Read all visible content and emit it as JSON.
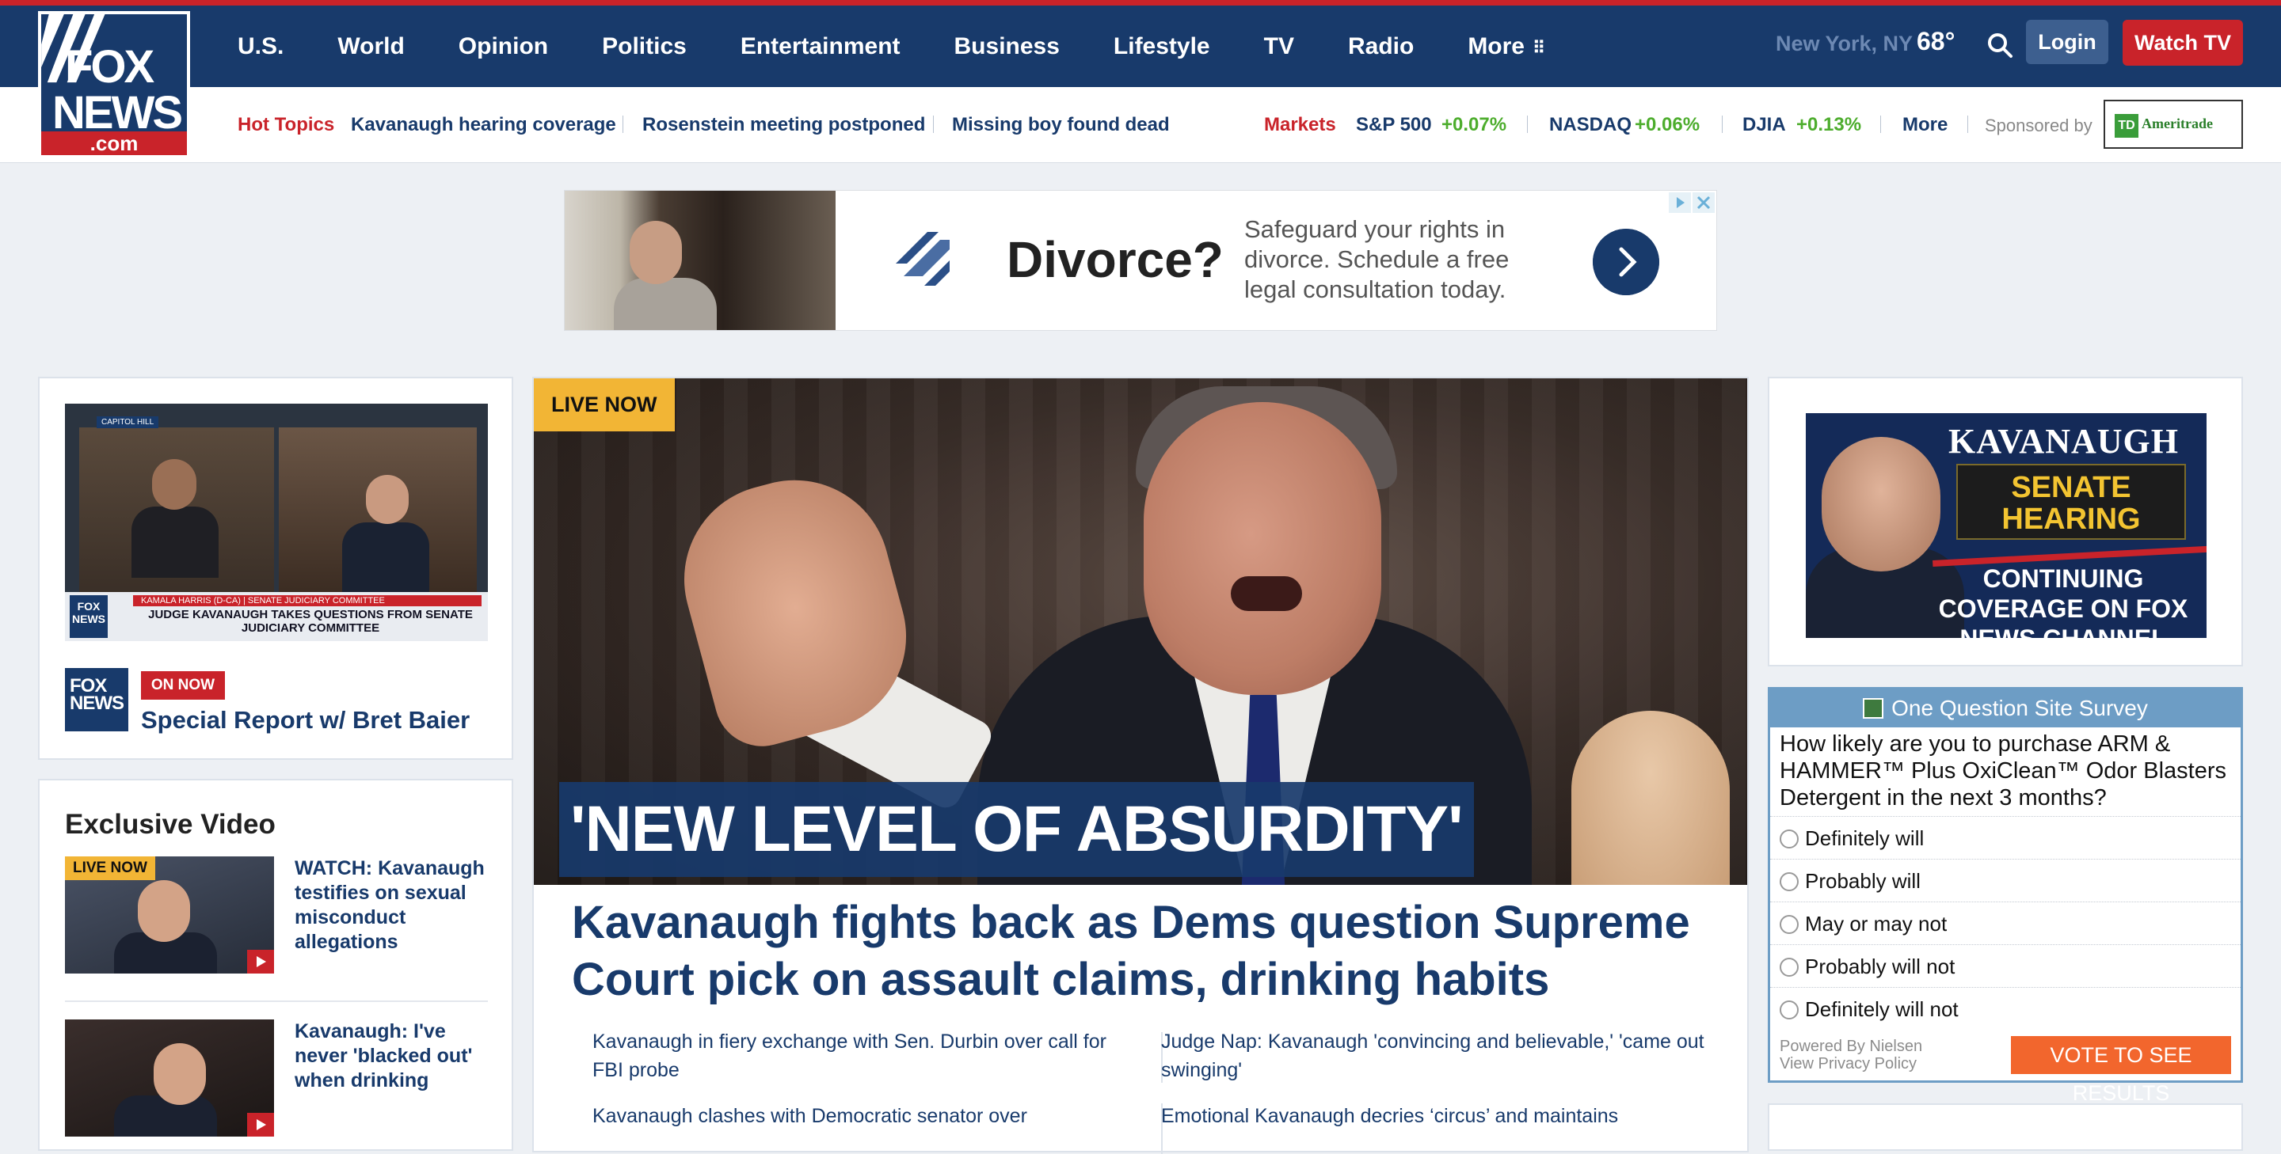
{
  "brand": {
    "logo_top": "FOX",
    "logo_bottom": "NEWS",
    "logo_suffix": ".com"
  },
  "nav": {
    "items": [
      "U.S.",
      "World",
      "Opinion",
      "Politics",
      "Entertainment",
      "Business",
      "Lifestyle",
      "TV",
      "Radio",
      "More"
    ]
  },
  "header": {
    "location": "New York, NY",
    "temperature": "68°",
    "login_label": "Login",
    "watch_label": "Watch TV"
  },
  "subbar": {
    "hot_topics_label": "Hot Topics",
    "topics": [
      "Kavanaugh hearing coverage",
      "Rosenstein meeting postponed",
      "Missing boy found dead"
    ],
    "markets_label": "Markets",
    "markets": [
      {
        "name": "S&P 500",
        "change": "+0.07%"
      },
      {
        "name": "NASDAQ",
        "change": "+0.06%"
      },
      {
        "name": "DJIA",
        "change": "+0.13%"
      }
    ],
    "more_label": "More",
    "sponsored_label": "Sponsored by",
    "sponsor_name": "Ameritrade",
    "sponsor_badge": "TD"
  },
  "ad_banner": {
    "headline": "Divorce?",
    "copy": "Safeguard your rights in divorce. Schedule a free legal consultation today."
  },
  "live_show": {
    "lower_third_bar": "KAMALA HARRIS (D-CA) | SENATE JUDICIARY COMMITTEE",
    "lower_third_text": "JUDGE KAVANAUGH TAKES QUESTIONS FROM SENATE JUDICIARY COMMITTEE",
    "location_tag": "CAPITOL HILL",
    "channel_logo": "FOX NEWS",
    "on_now_label": "ON NOW",
    "title": "Special Report w/ Bret Baier"
  },
  "exclusive_video": {
    "heading": "Exclusive Video",
    "items": [
      {
        "badge": "LIVE NOW",
        "title": "WATCH: Kavanaugh testifies on sexual misconduct allegations"
      },
      {
        "badge": "",
        "title": "Kavanaugh: I've never 'blacked out' when drinking"
      }
    ]
  },
  "main_story": {
    "live_badge": "LIVE NOW",
    "quote": "'NEW LEVEL OF ABSURDITY'",
    "headline": "Kavanaugh fights back as Dems question Supreme Court pick on assault claims, drinking habits",
    "related": [
      "Kavanaugh in fiery exchange with Sen. Durbin over call for FBI probe",
      "Judge Nap: Kavanaugh 'convincing and believable,' 'came out swinging'",
      "Kavanaugh clashes with Democratic senator over",
      "Emotional Kavanaugh decries ‘circus’ and maintains"
    ]
  },
  "side_ad": {
    "line1": "KAVANAUGH",
    "line2": "SENATE HEARING",
    "line3": "CONTINUING COVERAGE ON FOX NEWS CHANNEL"
  },
  "survey": {
    "title": "One Question Site Survey",
    "question": "How likely are you to purchase ARM & HAMMER™ Plus OxiClean™ Odor Blasters Detergent in the next 3 months?",
    "options": [
      "Definitely will",
      "Probably will",
      "May or may not",
      "Probably will not",
      "Definitely will not"
    ],
    "powered_by": "Powered By Nielsen",
    "privacy": "View Privacy Policy",
    "vote_label": "VOTE TO SEE RESULTS"
  },
  "colors": {
    "navy": "#183a6b",
    "red": "#c9232a",
    "gold": "#f2b535",
    "green": "#4dad2d",
    "survey_blue": "#6d9dc5",
    "vote_orange": "#f2662d"
  }
}
